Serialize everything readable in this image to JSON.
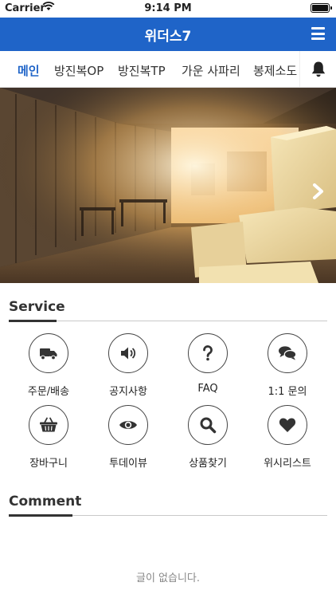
{
  "status_bar": {
    "carrier": "Carrier",
    "time": "9:14 PM"
  },
  "header": {
    "title": "위더스7"
  },
  "tabs": [
    {
      "label": "메인",
      "active": true
    },
    {
      "label": "방진복OP",
      "active": false
    },
    {
      "label": "방진복TP",
      "active": false
    },
    {
      "label": "가운 사파리",
      "active": false
    },
    {
      "label": "봉제소도",
      "active": false
    }
  ],
  "service": {
    "title": "Service",
    "items": [
      {
        "label": "주문/배송",
        "icon": "truck-icon"
      },
      {
        "label": "공지사항",
        "icon": "speaker-icon"
      },
      {
        "label": "FAQ",
        "icon": "question-icon"
      },
      {
        "label": "1:1 문의",
        "icon": "chat-icon"
      },
      {
        "label": "장바구니",
        "icon": "basket-icon"
      },
      {
        "label": "투데이뷰",
        "icon": "eye-icon"
      },
      {
        "label": "상품찾기",
        "icon": "search-icon"
      },
      {
        "label": "위시리스트",
        "icon": "heart-icon"
      }
    ]
  },
  "comment": {
    "title": "Comment",
    "empty_text": "글이 없습니다."
  },
  "colors": {
    "brand": "#1f64c8",
    "text": "#222222",
    "muted": "#888888"
  }
}
